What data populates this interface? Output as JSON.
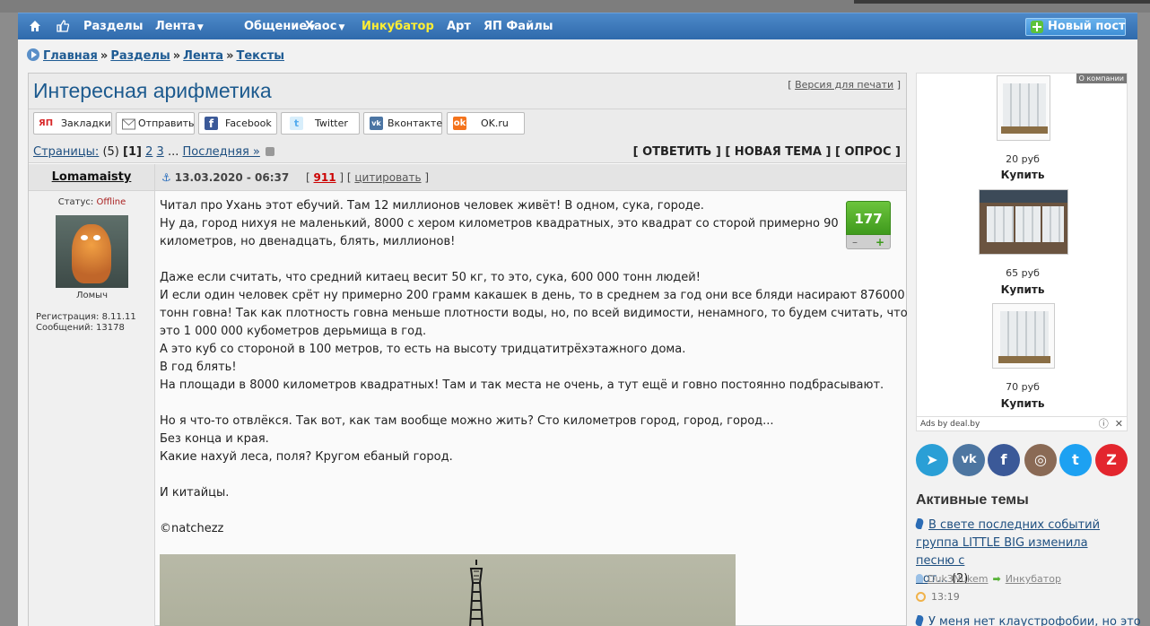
{
  "nav": {
    "items": [
      {
        "label": "Разделы",
        "caret": false,
        "highlight": false
      },
      {
        "label": "Лента",
        "caret": true,
        "highlight": false
      },
      {
        "label": "Общение",
        "caret": true,
        "highlight": false
      },
      {
        "label": "Хаос",
        "caret": true,
        "highlight": false
      },
      {
        "label": "Инкубатор",
        "caret": false,
        "highlight": true
      },
      {
        "label": "Арт",
        "caret": false,
        "highlight": false
      },
      {
        "label": "ЯП Файлы",
        "caret": false,
        "highlight": false
      }
    ],
    "new_post": "Новый пост"
  },
  "breadcrumb": [
    "Главная",
    "Разделы",
    "Лента",
    "Тексты"
  ],
  "breadcrumb_sep": "»",
  "topic": {
    "title": "Интересная арифметика",
    "print_link": "Версия для печати"
  },
  "share": [
    {
      "label": "Закладки",
      "icon": "yap-icon",
      "color": "#d8282a"
    },
    {
      "label": "Отправить",
      "icon": "mail-icon",
      "color": "#ffffff"
    },
    {
      "label": "Facebook",
      "icon": "facebook-icon",
      "color": "#3b5998"
    },
    {
      "label": "Twitter",
      "icon": "twitter-icon",
      "color": "#55acee"
    },
    {
      "label": "Вконтакте",
      "icon": "vk-icon",
      "color": "#4c75a3"
    },
    {
      "label": "OK.ru",
      "icon": "ok-icon",
      "color": "#f4731c"
    }
  ],
  "pager": {
    "label": "Страницы:",
    "total": "(5)",
    "current": "[1]",
    "pages": [
      "2",
      "3"
    ],
    "ellipsis": "...",
    "last": "Последняя »"
  },
  "actions": [
    "[ ОТВЕТИТЬ ]",
    "[ НОВАЯ ТЕМА ]",
    "[ ОПРОС ]"
  ],
  "post": {
    "author": "Lomamaisty",
    "status_label": "Статус:",
    "status_value": "Offline",
    "nick": "Ломыч",
    "reg_line": "Регистрация: 8.11.11",
    "posts_line": "Сообщений: 13178",
    "date": "13.03.2020 - 06:37",
    "post_number": "911",
    "quote_label": "цитировать",
    "rating": "177",
    "rating_minus": "–",
    "rating_plus": "+",
    "lines": [
      "Читал про Ухань этот ебучий. Там 12 миллионов человек живёт! В одном, сука, городе.",
      "Ну да, город нихуя не маленький, 8000 с хером километров квадратных, это квадрат со сторой примерно 90",
      "километров, но двенадцать, блять, миллионов!",
      "",
      "Даже если считать, что средний китаец весит 50 кг, то это, сука, 600 000 тонн людей!",
      "И если один человек срёт ну примерно 200 грамм какашек в день, то в среднем за год они все бляди насирают 876000",
      "тонн говна! Так как плотность говна меньше плотности воды, но, по всей видимости, ненамного, то будем считать, что",
      "это 1 000 000 кубометров дерьмища в год.",
      "А это куб со стороной в 100 метров, то есть на высоту тридцатитрёхэтажного дома.",
      "В год блять!",
      "На площади в 8000 километров квадратных! Там и так места не очень, а тут ещё и говно постоянно подбрасывают.",
      "",
      "Но я что-то отвлёкся. Так вот, как там вообще можно жить? Сто километров город, город, город...",
      "Без конца и края.",
      "Какие нахуй леса, поля? Кругом ебаный город.",
      "",
      "И китайцы.",
      "",
      "©natchezz"
    ]
  },
  "ads": {
    "company": "О компании",
    "items": [
      {
        "price": "20 руб",
        "buy": "Купить"
      },
      {
        "price": "65 руб",
        "buy": "Купить"
      },
      {
        "price": "70 руб",
        "buy": "Купить"
      }
    ],
    "footer": "Ads by deal.by"
  },
  "social": [
    {
      "icon": "telegram-icon",
      "color": "#2a9fd6",
      "glyph": "➤"
    },
    {
      "icon": "vk-icon",
      "color": "#4d76a1",
      "glyph": "vk"
    },
    {
      "icon": "facebook-icon",
      "color": "#3b5998",
      "glyph": "f"
    },
    {
      "icon": "instagram-icon",
      "color": "#8a6a55",
      "glyph": "◎"
    },
    {
      "icon": "twitter-icon",
      "color": "#1da1f2",
      "glyph": "t"
    },
    {
      "icon": "zen-icon",
      "color": "#e3262e",
      "glyph": "Z"
    }
  ],
  "active_topics": {
    "title": "Активные темы",
    "items": [
      {
        "lines": [
          "В свете последних событий",
          "группа LITTLE BIG изменила песню с",
          "кот..."
        ],
        "count": "(2)",
        "user": "Duk3Nukem",
        "section": "Инкубатор",
        "time": "13:19"
      },
      {
        "lines": [
          "У меня нет клаустрофобии, но это"
        ]
      }
    ]
  }
}
